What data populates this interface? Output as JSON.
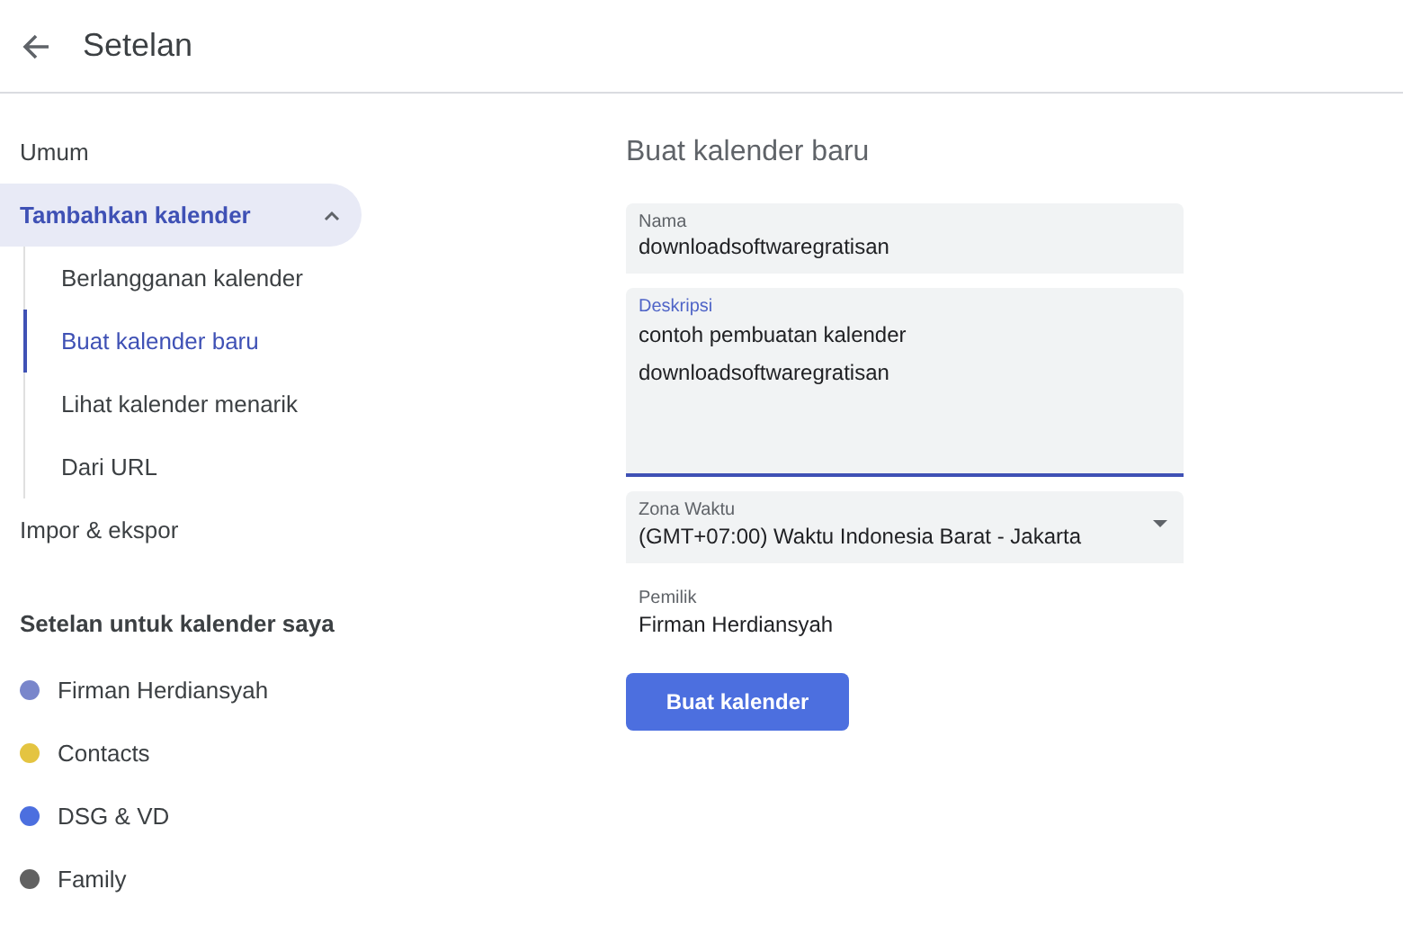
{
  "header": {
    "title": "Setelan"
  },
  "sidebar": {
    "items": [
      {
        "label": "Umum",
        "selected": false
      },
      {
        "label": "Tambahkan kalender",
        "selected": true,
        "expanded": true,
        "children": [
          {
            "label": "Berlangganan kalender",
            "selected": false
          },
          {
            "label": "Buat kalender baru",
            "selected": true
          },
          {
            "label": "Lihat kalender menarik",
            "selected": false
          },
          {
            "label": "Dari URL",
            "selected": false
          }
        ]
      },
      {
        "label": "Impor & ekspor",
        "selected": false
      }
    ],
    "section_title": "Setelan untuk kalender saya",
    "calendars": [
      {
        "label": "Firman Herdiansyah",
        "color": "#7986cb"
      },
      {
        "label": "Contacts",
        "color": "#e4c441"
      },
      {
        "label": "DSG & VD",
        "color": "#4c6fdf"
      },
      {
        "label": "Family",
        "color": "#616161"
      }
    ]
  },
  "form": {
    "title": "Buat kalender baru",
    "fields": [
      {
        "kind": "text",
        "label": "Nama",
        "value": "downloadsoftwaregratisan",
        "focused": false
      },
      {
        "kind": "textarea",
        "label": "Deskripsi",
        "value": "contoh pembuatan kalender\ndownloadsoftwaregratisan",
        "focused": true
      },
      {
        "kind": "select",
        "label": "Zona Waktu",
        "value": "(GMT+07:00) Waktu Indonesia Barat - Jakarta",
        "focused": false
      },
      {
        "kind": "readonly",
        "label": "Pemilik",
        "value": "Firman Herdiansyah"
      }
    ],
    "button": "Buat kalender"
  }
}
